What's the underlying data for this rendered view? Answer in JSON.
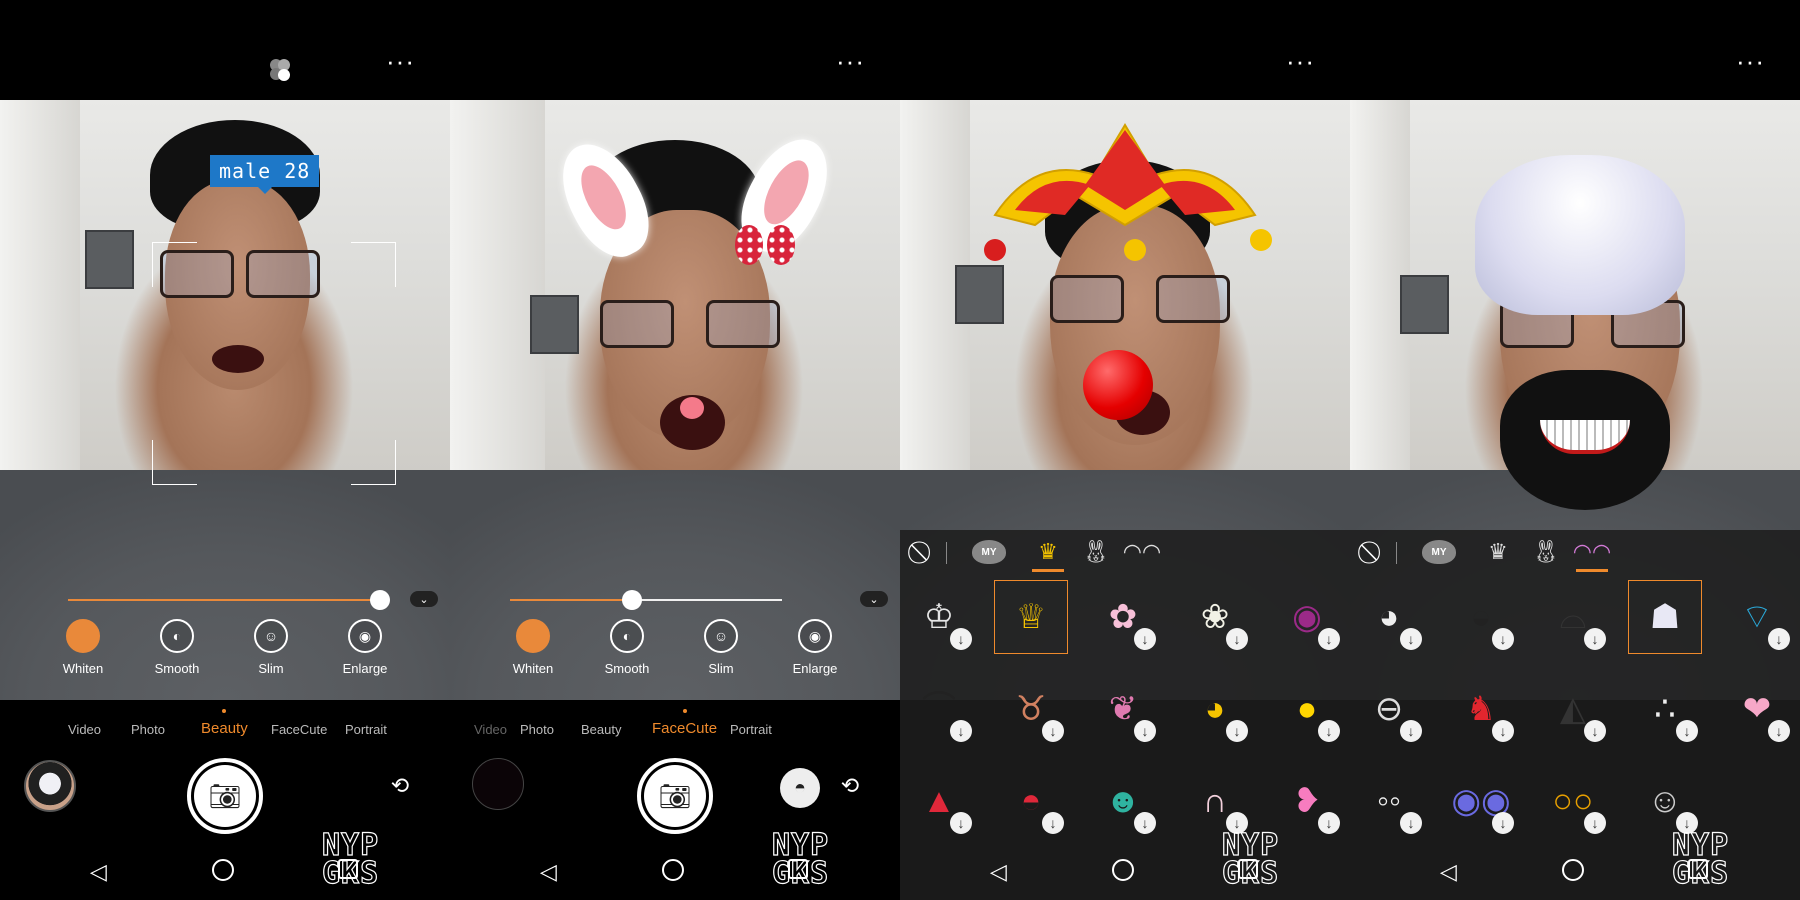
{
  "screens": [
    {
      "id": "beauty",
      "age_tag": "male  28",
      "more_label": "···",
      "slider_value": 1.0,
      "tools": [
        {
          "label": "Whiten",
          "icon": "whiten-icon",
          "glyph": "≡",
          "active": true
        },
        {
          "label": "Smooth",
          "icon": "smooth-icon",
          "glyph": "◐",
          "active": false
        },
        {
          "label": "Slim",
          "icon": "slim-icon",
          "glyph": "☺",
          "active": false
        },
        {
          "label": "Enlarge",
          "icon": "enlarge-icon",
          "glyph": "◉",
          "active": false
        }
      ],
      "modes": [
        "Video",
        "Photo",
        "Beauty",
        "FaceCute",
        "Portrait"
      ],
      "active_mode": "Beauty"
    },
    {
      "id": "facecute-bunny",
      "more_label": "···",
      "slider_value": 0.45,
      "tools": [
        {
          "label": "Whiten",
          "icon": "whiten-icon",
          "glyph": "≡",
          "active": true
        },
        {
          "label": "Smooth",
          "icon": "smooth-icon",
          "glyph": "◐",
          "active": false
        },
        {
          "label": "Slim",
          "icon": "slim-icon",
          "glyph": "☺",
          "active": false
        },
        {
          "label": "Enlarge",
          "icon": "enlarge-icon",
          "glyph": "◉",
          "active": false
        }
      ],
      "modes": [
        "Video",
        "Photo",
        "Beauty",
        "FaceCute",
        "Portrait"
      ],
      "active_mode": "FaceCute"
    },
    {
      "id": "stickers-crown",
      "more_label": "···",
      "my_label": "MY",
      "active_category": "crown"
    },
    {
      "id": "stickers-mask",
      "more_label": "···",
      "my_label": "MY",
      "active_category": "mask"
    }
  ],
  "watermark": "NYP\nGKS",
  "accent_color": "#ef8a2c"
}
